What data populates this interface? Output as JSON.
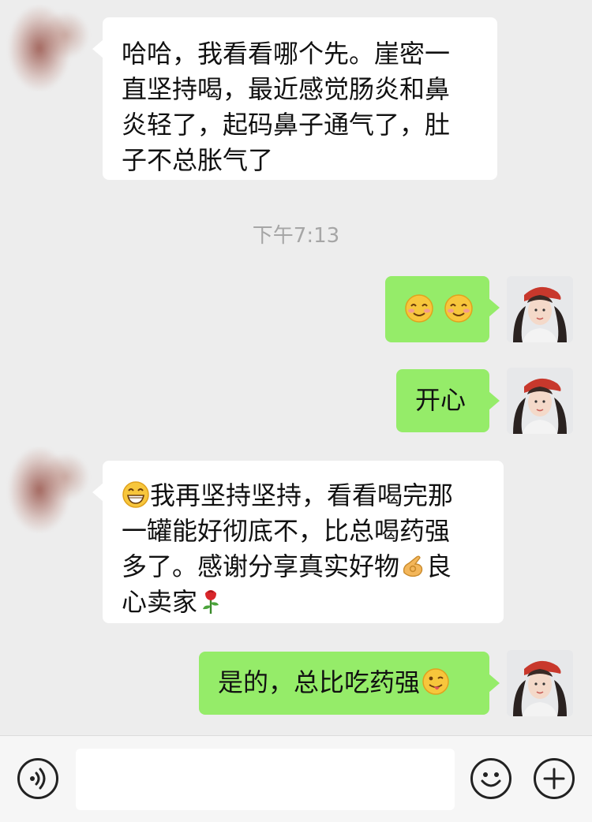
{
  "messages": [
    {
      "side": "left",
      "text": "哈哈，我看看哪个先。崖密一\n直坚持喝，最近感觉肠炎和鼻\n炎轻了，起码鼻子通气了，肚\n子不总胀气了"
    },
    {
      "side": "time",
      "text": "下午7:13"
    },
    {
      "side": "right",
      "emojis": [
        "blush-emoji",
        "blush-emoji"
      ]
    },
    {
      "side": "right",
      "text": "开心"
    },
    {
      "side": "left",
      "lead_emoji": "grin-emoji",
      "line1": "我再坚持坚持，看看喝完那",
      "line2": "一罐能好彻底不，比总喝药强",
      "line3": "多了。感谢分享真实好物",
      "mid_emoji": "ok-hand-emoji",
      "line3b": "良",
      "line4": "心卖家",
      "tail_emoji": "rose-emoji"
    },
    {
      "side": "right",
      "text": "是的，总比吃药强",
      "tail_emoji": "wink-tongue-emoji"
    }
  ],
  "input_bar": {
    "voice_icon": "voice-icon",
    "emoji_icon": "smiley-icon",
    "plus_icon": "plus-icon"
  },
  "colors": {
    "background": "#ededed",
    "sent_bubble": "#95ec69",
    "received_bubble": "#ffffff"
  }
}
